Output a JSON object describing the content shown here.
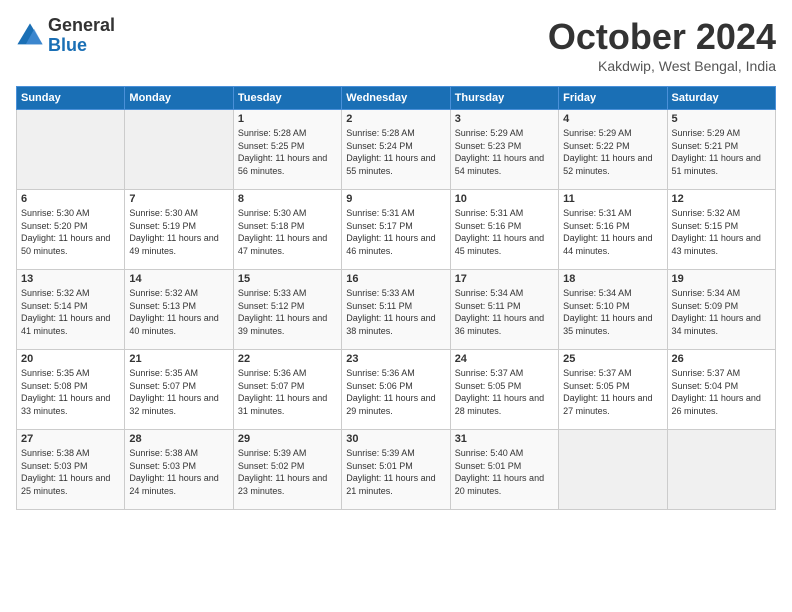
{
  "header": {
    "logo_line1": "General",
    "logo_line2": "Blue",
    "month": "October 2024",
    "location": "Kakdwip, West Bengal, India"
  },
  "weekdays": [
    "Sunday",
    "Monday",
    "Tuesday",
    "Wednesday",
    "Thursday",
    "Friday",
    "Saturday"
  ],
  "weeks": [
    [
      {
        "day": "",
        "sunrise": "",
        "sunset": "",
        "daylight": ""
      },
      {
        "day": "",
        "sunrise": "",
        "sunset": "",
        "daylight": ""
      },
      {
        "day": "1",
        "sunrise": "Sunrise: 5:28 AM",
        "sunset": "Sunset: 5:25 PM",
        "daylight": "Daylight: 11 hours and 56 minutes."
      },
      {
        "day": "2",
        "sunrise": "Sunrise: 5:28 AM",
        "sunset": "Sunset: 5:24 PM",
        "daylight": "Daylight: 11 hours and 55 minutes."
      },
      {
        "day": "3",
        "sunrise": "Sunrise: 5:29 AM",
        "sunset": "Sunset: 5:23 PM",
        "daylight": "Daylight: 11 hours and 54 minutes."
      },
      {
        "day": "4",
        "sunrise": "Sunrise: 5:29 AM",
        "sunset": "Sunset: 5:22 PM",
        "daylight": "Daylight: 11 hours and 52 minutes."
      },
      {
        "day": "5",
        "sunrise": "Sunrise: 5:29 AM",
        "sunset": "Sunset: 5:21 PM",
        "daylight": "Daylight: 11 hours and 51 minutes."
      }
    ],
    [
      {
        "day": "6",
        "sunrise": "Sunrise: 5:30 AM",
        "sunset": "Sunset: 5:20 PM",
        "daylight": "Daylight: 11 hours and 50 minutes."
      },
      {
        "day": "7",
        "sunrise": "Sunrise: 5:30 AM",
        "sunset": "Sunset: 5:19 PM",
        "daylight": "Daylight: 11 hours and 49 minutes."
      },
      {
        "day": "8",
        "sunrise": "Sunrise: 5:30 AM",
        "sunset": "Sunset: 5:18 PM",
        "daylight": "Daylight: 11 hours and 47 minutes."
      },
      {
        "day": "9",
        "sunrise": "Sunrise: 5:31 AM",
        "sunset": "Sunset: 5:17 PM",
        "daylight": "Daylight: 11 hours and 46 minutes."
      },
      {
        "day": "10",
        "sunrise": "Sunrise: 5:31 AM",
        "sunset": "Sunset: 5:16 PM",
        "daylight": "Daylight: 11 hours and 45 minutes."
      },
      {
        "day": "11",
        "sunrise": "Sunrise: 5:31 AM",
        "sunset": "Sunset: 5:16 PM",
        "daylight": "Daylight: 11 hours and 44 minutes."
      },
      {
        "day": "12",
        "sunrise": "Sunrise: 5:32 AM",
        "sunset": "Sunset: 5:15 PM",
        "daylight": "Daylight: 11 hours and 43 minutes."
      }
    ],
    [
      {
        "day": "13",
        "sunrise": "Sunrise: 5:32 AM",
        "sunset": "Sunset: 5:14 PM",
        "daylight": "Daylight: 11 hours and 41 minutes."
      },
      {
        "day": "14",
        "sunrise": "Sunrise: 5:32 AM",
        "sunset": "Sunset: 5:13 PM",
        "daylight": "Daylight: 11 hours and 40 minutes."
      },
      {
        "day": "15",
        "sunrise": "Sunrise: 5:33 AM",
        "sunset": "Sunset: 5:12 PM",
        "daylight": "Daylight: 11 hours and 39 minutes."
      },
      {
        "day": "16",
        "sunrise": "Sunrise: 5:33 AM",
        "sunset": "Sunset: 5:11 PM",
        "daylight": "Daylight: 11 hours and 38 minutes."
      },
      {
        "day": "17",
        "sunrise": "Sunrise: 5:34 AM",
        "sunset": "Sunset: 5:11 PM",
        "daylight": "Daylight: 11 hours and 36 minutes."
      },
      {
        "day": "18",
        "sunrise": "Sunrise: 5:34 AM",
        "sunset": "Sunset: 5:10 PM",
        "daylight": "Daylight: 11 hours and 35 minutes."
      },
      {
        "day": "19",
        "sunrise": "Sunrise: 5:34 AM",
        "sunset": "Sunset: 5:09 PM",
        "daylight": "Daylight: 11 hours and 34 minutes."
      }
    ],
    [
      {
        "day": "20",
        "sunrise": "Sunrise: 5:35 AM",
        "sunset": "Sunset: 5:08 PM",
        "daylight": "Daylight: 11 hours and 33 minutes."
      },
      {
        "day": "21",
        "sunrise": "Sunrise: 5:35 AM",
        "sunset": "Sunset: 5:07 PM",
        "daylight": "Daylight: 11 hours and 32 minutes."
      },
      {
        "day": "22",
        "sunrise": "Sunrise: 5:36 AM",
        "sunset": "Sunset: 5:07 PM",
        "daylight": "Daylight: 11 hours and 31 minutes."
      },
      {
        "day": "23",
        "sunrise": "Sunrise: 5:36 AM",
        "sunset": "Sunset: 5:06 PM",
        "daylight": "Daylight: 11 hours and 29 minutes."
      },
      {
        "day": "24",
        "sunrise": "Sunrise: 5:37 AM",
        "sunset": "Sunset: 5:05 PM",
        "daylight": "Daylight: 11 hours and 28 minutes."
      },
      {
        "day": "25",
        "sunrise": "Sunrise: 5:37 AM",
        "sunset": "Sunset: 5:05 PM",
        "daylight": "Daylight: 11 hours and 27 minutes."
      },
      {
        "day": "26",
        "sunrise": "Sunrise: 5:37 AM",
        "sunset": "Sunset: 5:04 PM",
        "daylight": "Daylight: 11 hours and 26 minutes."
      }
    ],
    [
      {
        "day": "27",
        "sunrise": "Sunrise: 5:38 AM",
        "sunset": "Sunset: 5:03 PM",
        "daylight": "Daylight: 11 hours and 25 minutes."
      },
      {
        "day": "28",
        "sunrise": "Sunrise: 5:38 AM",
        "sunset": "Sunset: 5:03 PM",
        "daylight": "Daylight: 11 hours and 24 minutes."
      },
      {
        "day": "29",
        "sunrise": "Sunrise: 5:39 AM",
        "sunset": "Sunset: 5:02 PM",
        "daylight": "Daylight: 11 hours and 23 minutes."
      },
      {
        "day": "30",
        "sunrise": "Sunrise: 5:39 AM",
        "sunset": "Sunset: 5:01 PM",
        "daylight": "Daylight: 11 hours and 21 minutes."
      },
      {
        "day": "31",
        "sunrise": "Sunrise: 5:40 AM",
        "sunset": "Sunset: 5:01 PM",
        "daylight": "Daylight: 11 hours and 20 minutes."
      },
      {
        "day": "",
        "sunrise": "",
        "sunset": "",
        "daylight": ""
      },
      {
        "day": "",
        "sunrise": "",
        "sunset": "",
        "daylight": ""
      }
    ]
  ]
}
